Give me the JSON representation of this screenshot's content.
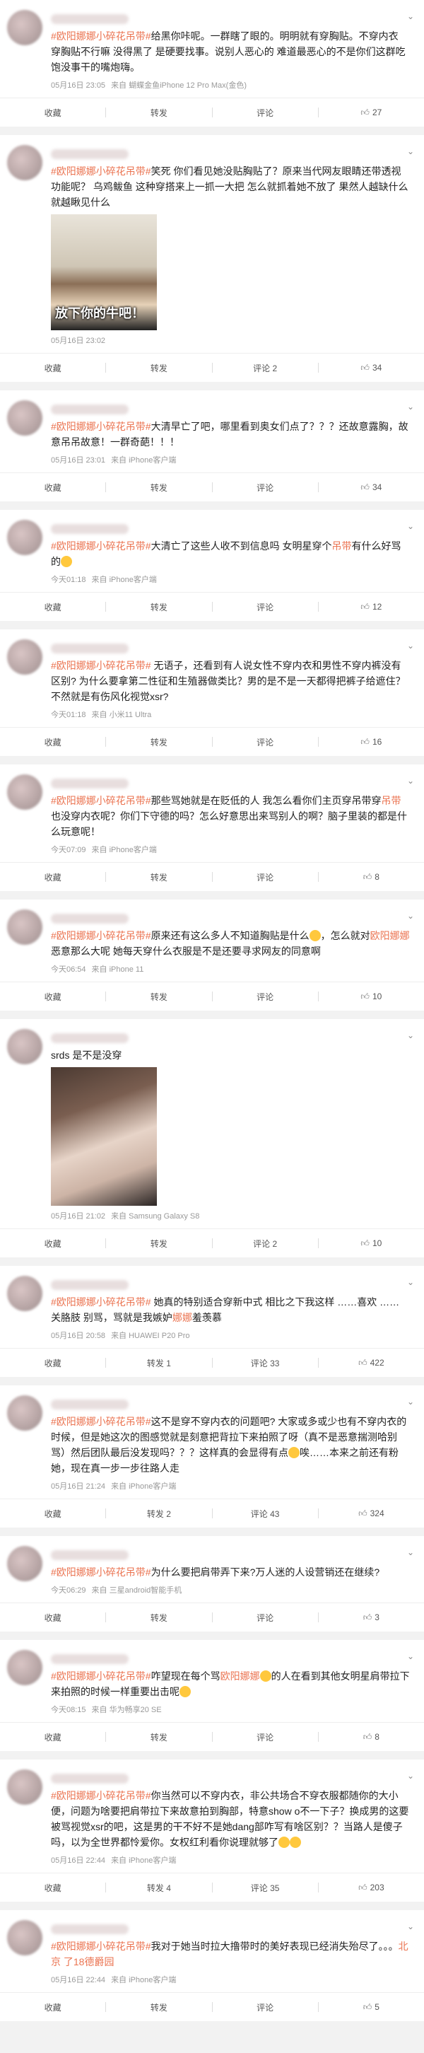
{
  "labels": {
    "collect": "收藏",
    "forward": "转发",
    "comment": "评论",
    "like_icon": "thumbs-up-icon"
  },
  "posts": [
    {
      "segments": [
        {
          "t": "#欧阳娜娜小碎花吊带#",
          "topic": true
        },
        {
          "t": "给黑你咔呢。一群瞎了眼的。明明就有穿胸贴。不穿内衣 穿胸贴不行嘛 没得黑了 是硬要找事。说别人恶心的 难道最恶心的不是你们这群吃饱没事干的嘴炮嗨。"
        }
      ],
      "time": "05月16日 23:05",
      "source": "来自 蝴蝶金鱼iPhone 12 Pro Max(金色)",
      "comment_label": "评论",
      "likes": "27",
      "media": null
    },
    {
      "segments": [
        {
          "t": "#欧阳娜娜小碎花吊带#",
          "topic": true
        },
        {
          "t": "笑死 你们看见她没贴胸贴了？原来当代网友眼睛还带透视功能呢？ 乌鸡鲅鱼 这种穿搭来上一抓一大把 怎么就抓着她不放了 果然人越缺什么就越瞅见什么"
        }
      ],
      "time": "05月16日 23:02",
      "source": "",
      "comment_label": "评论 2",
      "likes": "34",
      "media": {
        "kind": "face",
        "caption": "放下你的牛吧！"
      }
    },
    {
      "segments": [
        {
          "t": "#欧阳娜娜小碎花吊带#",
          "topic": true
        },
        {
          "t": "大清早亡了吧，哪里看到奥女们点了？？？还故意露胸，故意吊吊故意！一群奇葩！！！"
        }
      ],
      "time": "05月16日 23:01",
      "source": "来自 iPhone客户端",
      "comment_label": "评论",
      "likes": "34",
      "media": null
    },
    {
      "segments": [
        {
          "t": "#欧阳娜娜小碎花吊带#",
          "topic": true
        },
        {
          "t": "大清亡了这些人收不到信息吗 女明星穿个"
        },
        {
          "t": "吊带",
          "topic": true
        },
        {
          "t": "有什么好骂的"
        },
        {
          "t": "",
          "emoji": true
        }
      ],
      "time": "今天01:18",
      "source": "来自 iPhone客户端",
      "comment_label": "评论",
      "likes": "12",
      "media": null
    },
    {
      "segments": [
        {
          "t": "#欧阳娜娜小碎花吊带#",
          "topic": true
        },
        {
          "t": " 无语子，还看到有人说女性不穿内衣和男性不穿内裤没有区别? 为什么要拿第二性征和生殖器做类比？男的是不是一天都得把裤子给遮住？不然就是有伤风化视觉xsr?"
        }
      ],
      "time": "今天01:18",
      "source": "来自 小米11 Ultra",
      "comment_label": "评论",
      "likes": "16",
      "media": null
    },
    {
      "segments": [
        {
          "t": "#欧阳娜娜小碎花吊带#",
          "topic": true
        },
        {
          "t": "那些骂她就是在贬低的人 我怎么看你们主页穿吊带穿"
        },
        {
          "t": "吊带",
          "topic": true
        },
        {
          "t": "也没穿内衣呢？你们下守德的吗？怎么好意思出来骂别人的啊？脑子里装的都是什么玩意呢！"
        }
      ],
      "time": "今天07:09",
      "source": "来自 iPhone客户端",
      "comment_label": "评论",
      "likes": "8",
      "media": null
    },
    {
      "segments": [
        {
          "t": "#欧阳娜娜小碎花吊带#",
          "topic": true
        },
        {
          "t": "原来还有这么多人不知道胸贴是什么"
        },
        {
          "t": "",
          "emoji": true
        },
        {
          "t": "，怎么就对"
        },
        {
          "t": "欧阳娜娜",
          "topic": true
        },
        {
          "t": "恶意那么大呢 她每天穿什么衣服是不是还要寻求网友的同意啊"
        }
      ],
      "time": "今天06:54",
      "source": "来自 iPhone 11",
      "comment_label": "评论",
      "likes": "10",
      "media": null
    },
    {
      "segments": [
        {
          "t": "srds 是不是没穿"
        }
      ],
      "time": "05月16日 21:02",
      "source": "来自 Samsung Galaxy S8",
      "comment_label": "评论 2",
      "likes": "10",
      "media": {
        "kind": "girl",
        "caption": ""
      }
    },
    {
      "segments": [
        {
          "t": "#欧阳娜娜小碎花吊带#",
          "topic": true
        },
        {
          "t": " 她真的特别适合穿新",
          "topic": false
        },
        {
          "t": "中式",
          "topic": false
        },
        {
          "t": " 相比之下我这样 ……喜欢 …… 关胳肢 别骂，骂就是我嫉妒"
        },
        {
          "t": "娜娜",
          "topic": true
        },
        {
          "t": "羞羡慕"
        }
      ],
      "time": "05月16日 20:58",
      "source": "来自 HUAWEI P20 Pro",
      "comment_label": "评论 33",
      "forward_label": "转发 1",
      "likes": "422",
      "media": null
    },
    {
      "segments": [
        {
          "t": "#欧阳娜娜小碎花吊带#",
          "topic": true
        },
        {
          "t": "这不是穿不穿内衣的问题吧? 大家或多或少也有不穿内衣的时候，但是她这次的图感觉就是刻意把背拉下来拍照了呀（真不是恶意揣测哈别骂）然后团队最后没发现吗？？？这样真的会显得有点"
        },
        {
          "t": "",
          "emoji": true
        },
        {
          "t": "唉……本来之前还有粉她，现在真一步一步往路人走"
        }
      ],
      "time": "05月16日 21:24",
      "source": "来自 iPhone客户端",
      "comment_label": "评论 43",
      "forward_label": "转发 2",
      "likes": "324",
      "media": null
    },
    {
      "segments": [
        {
          "t": "#欧阳娜娜小碎花吊带#",
          "topic": true
        },
        {
          "t": "为什么要把肩带弄下来?万人迷的人设营销还在继续?"
        }
      ],
      "time": "今天06:29",
      "source": "来自 三星android智能手机",
      "comment_label": "评论",
      "likes": "3",
      "media": null
    },
    {
      "segments": [
        {
          "t": "#欧阳娜娜小碎花吊带#",
          "topic": true
        },
        {
          "t": "咋望现在每个骂"
        },
        {
          "t": "欧阳娜娜",
          "topic": true
        },
        {
          "t": "",
          "emoji": true
        },
        {
          "t": "的人在看到其他女明星肩带拉下来拍照的时候一样重要出击呢"
        },
        {
          "t": "",
          "emoji": true
        }
      ],
      "time": "今天08:15",
      "source": "来自 华为畅享20 SE",
      "comment_label": "评论",
      "likes": "8",
      "media": null
    },
    {
      "segments": [
        {
          "t": "#欧阳娜娜小碎花吊带#",
          "topic": true
        },
        {
          "t": "你当然可以不穿内衣，非公共场合不穿衣服都随你的大小便，问题为啥要把肩带拉下来故意拍到胸部，特意show o不一下子？换成男的这要被骂视觉xsr的吧，这是男的干不好不是她dang部咋写有啥区别？？当路人是傻子吗，以为全世界都怜爱你。女权红利看你说理就够了"
        },
        {
          "t": "",
          "emoji": true
        },
        {
          "t": "",
          "emoji": true
        }
      ],
      "time": "05月16日 22:44",
      "source": "来自 iPhone客户端",
      "comment_label": "评论 35",
      "forward_label": "转发 4",
      "likes": "203",
      "media": null
    },
    {
      "segments": [
        {
          "t": "#欧阳娜娜小碎花吊带#",
          "topic": true
        },
        {
          "t": "我对于她当时拉大撸带时的美好表现已经消失殆尽了。。。"
        },
        {
          "t": "北京 了18德爵园",
          "topic": true
        }
      ],
      "time": "05月16日 22:44",
      "source": "来自 iPhone客户端",
      "comment_label": "评论",
      "likes": "5",
      "media": null
    }
  ]
}
